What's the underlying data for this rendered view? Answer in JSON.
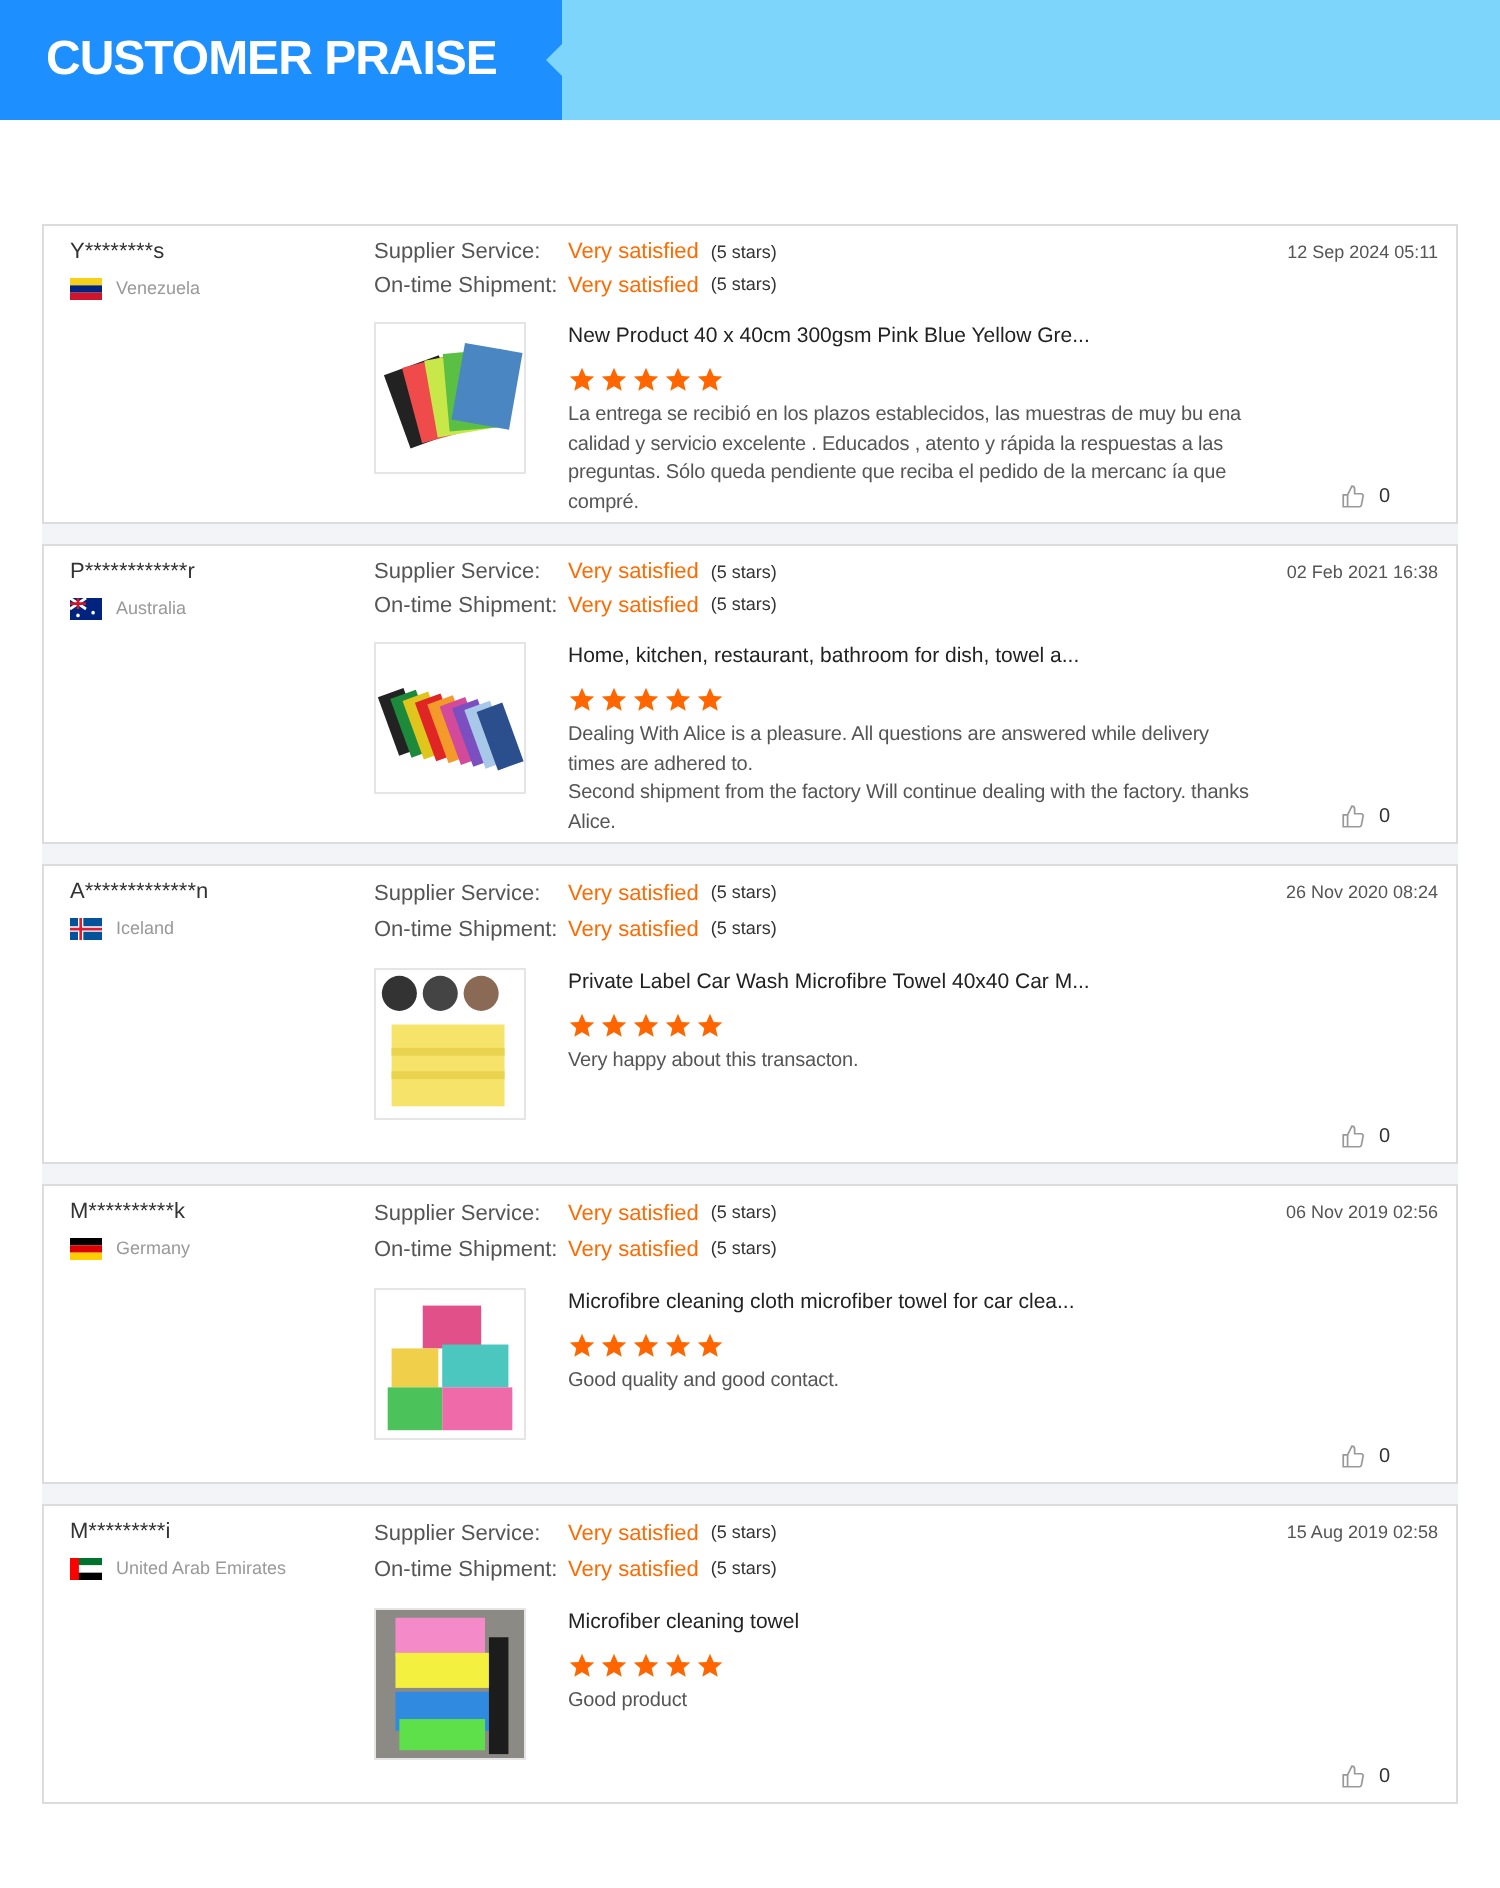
{
  "header": {
    "title": "CUSTOMER PRAISE"
  },
  "reviews": [
    {
      "user": "Y********s",
      "country": "Venezuela",
      "date": "12 Sep 2024 05:11",
      "ratings": [
        {
          "label": "Supplier Service:",
          "value": "Very satisfied",
          "note": "(5 stars)"
        },
        {
          "label": "On-time Shipment:",
          "value": "Very satisfied",
          "note": "(5 stars)"
        }
      ],
      "product": "New Product 40 x 40cm 300gsm Pink Blue Yellow Gre...",
      "stars": 5,
      "comment": "La entrega se recibió en los plazos establecidos, las muestras de muy bu ena calidad y servicio excelente . Educados , atento y rápida la respuestas a las preguntas. Sólo queda pendiente que reciba el pedido de la mercanc ía que compré.",
      "likes": "0"
    },
    {
      "user": "P************r",
      "country": "Australia",
      "date": "02 Feb 2021 16:38",
      "ratings": [
        {
          "label": "Supplier Service:",
          "value": "Very satisfied",
          "note": "(5 stars)"
        },
        {
          "label": "On-time Shipment:",
          "value": "Very satisfied",
          "note": "(5 stars)"
        }
      ],
      "product": "Home, kitchen, restaurant, bathroom for dish, towel a...",
      "stars": 5,
      "comment": "Dealing With Alice is a pleasure. All questions are answered while delivery times are adhered to.\nSecond shipment from the factory Will continue dealing with the factory. thanks Alice.",
      "likes": "0"
    },
    {
      "user": "A*************n",
      "country": "Iceland",
      "date": "26 Nov 2020 08:24",
      "ratings": [
        {
          "label": "Supplier Service:",
          "value": "Very satisfied",
          "note": "(5 stars)"
        },
        {
          "label": "On-time Shipment:",
          "value": "Very satisfied",
          "note": "(5 stars)"
        }
      ],
      "product": "Private Label Car Wash Microfibre Towel 40x40 Car M...",
      "stars": 5,
      "comment": "Very happy about this transacton.",
      "likes": "0"
    },
    {
      "user": "M**********k",
      "country": "Germany",
      "date": "06 Nov 2019 02:56",
      "ratings": [
        {
          "label": "Supplier Service:",
          "value": "Very satisfied",
          "note": "(5 stars)"
        },
        {
          "label": "On-time Shipment:",
          "value": "Very satisfied",
          "note": "(5 stars)"
        }
      ],
      "product": "Microfibre cleaning cloth microfiber towel for car clea...",
      "stars": 5,
      "comment": "Good quality and good contact.",
      "likes": "0"
    },
    {
      "user": "M*********i",
      "country": "United Arab Emirates",
      "date": "15 Aug 2019 02:58",
      "ratings": [
        {
          "label": "Supplier Service:",
          "value": "Very satisfied",
          "note": "(5 stars)"
        },
        {
          "label": "On-time Shipment:",
          "value": "Very satisfied",
          "note": "(5 stars)"
        }
      ],
      "product": "Microfiber cleaning towel",
      "stars": 5,
      "comment": "Good product",
      "likes": "0"
    }
  ]
}
